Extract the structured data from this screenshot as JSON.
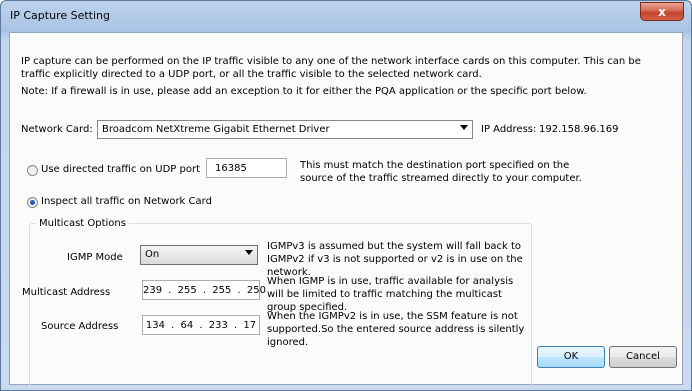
{
  "window": {
    "title": "IP Capture Setting",
    "close_glyph": "x"
  },
  "intro": "IP capture can be performed on the IP traffic visible to any one of the network interface cards on this computer. This can be traffic explicitly directed to a UDP port, or all the traffic visible to the selected network card.",
  "note": "Note: If a firewall is in use, please add an exception to it for either the PQA application or the specific port below.",
  "network_card": {
    "label": "Network Card:",
    "value": "Broadcom NetXtreme Gigabit Ethernet Driver",
    "ip_label": "IP Address:",
    "ip_value": "192.158.96.169"
  },
  "udp_option": {
    "label": "Use directed traffic on UDP port",
    "selected": false,
    "port": "16385",
    "help": "This must match the destination port specified on the source of the traffic streamed directly to your computer."
  },
  "inspect_option": {
    "label": "Inspect all traffic on Network Card",
    "selected": true
  },
  "multicast": {
    "group_title": "Multicast Options",
    "igmp_label": "IGMP Mode",
    "igmp_value": "On",
    "igmp_help": "IGMPv3 is assumed but the system will fall back to IGMPv2 if v3 is not supported or v2 is in use on the network.",
    "address_label": "Multicast Address",
    "address_value": "239 . 255 . 255 . 250",
    "address_help": "When IGMP is in use, traffic available for analysis will be limited to traffic matching the multicast group specified.",
    "source_label": "Source Address",
    "source_value": "134 . 64 . 233 . 17",
    "source_help": "When the IGMPv2 is in use, the SSM feature is not supported.So the entered source address is silently ignored."
  },
  "buttons": {
    "ok": "OK",
    "cancel": "Cancel"
  },
  "colors": {
    "accent": "#1f5fb3",
    "title_bar": "#bcd3ec",
    "close": "#c2452b"
  }
}
